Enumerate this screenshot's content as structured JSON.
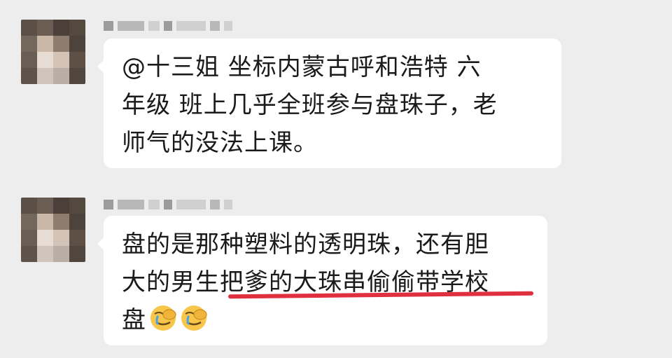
{
  "messages": [
    {
      "lines": [
        "@十三姐 坐标内蒙古呼和浩特 六",
        "年级 班上几乎全班参与盘珠子，老",
        "师气的没法上课。"
      ]
    },
    {
      "lines": [
        "盘的是那种塑料的透明珠，还有胆",
        "大的男生把爹的大珠串偷偷带学校",
        "盘"
      ],
      "emojis": [
        "face-palm-crying-emoji",
        "face-palm-crying-emoji"
      ]
    }
  ],
  "colors": {
    "background": "#ededed",
    "bubble": "#ffffff",
    "text": "#1a1a1a",
    "annotation": "#e0303f"
  }
}
